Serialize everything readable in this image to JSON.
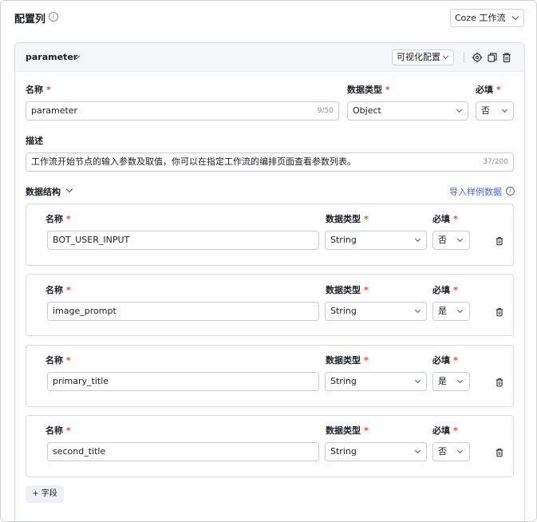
{
  "header": {
    "title": "配置列",
    "source_select": "Coze 工作流"
  },
  "card": {
    "name": "parameter",
    "mode_button": "可视化配置",
    "fields": {
      "name_label": "名称",
      "type_label": "数据类型",
      "required_label": "必填",
      "name_value": "parameter",
      "name_counter": "9/50",
      "type_value": "Object",
      "required_value": "否"
    },
    "description": {
      "label": "描述",
      "value": "工作流开始节点的输入参数及取值，你可以在指定工作流的编排页面查看参数列表。",
      "counter": "37/200"
    },
    "structure": {
      "label": "数据结构",
      "import_link": "导入样例数据",
      "rows": [
        {
          "name_label": "名称",
          "type_label": "数据类型",
          "required_label": "必填",
          "name": "BOT_USER_INPUT",
          "type": "String",
          "required": "否"
        },
        {
          "name_label": "名称",
          "type_label": "数据类型",
          "required_label": "必填",
          "name": "image_prompt",
          "type": "String",
          "required": "是"
        },
        {
          "name_label": "名称",
          "type_label": "数据类型",
          "required_label": "必填",
          "name": "primary_title",
          "type": "String",
          "required": "是"
        },
        {
          "name_label": "名称",
          "type_label": "数据类型",
          "required_label": "必填",
          "name": "second_title",
          "type": "String",
          "required": "否"
        }
      ]
    },
    "add_field_button": "+ 字段"
  },
  "colors": {
    "required_mark": "#e5483a",
    "link": "#3c68e6",
    "border": "#c8ccd2"
  }
}
